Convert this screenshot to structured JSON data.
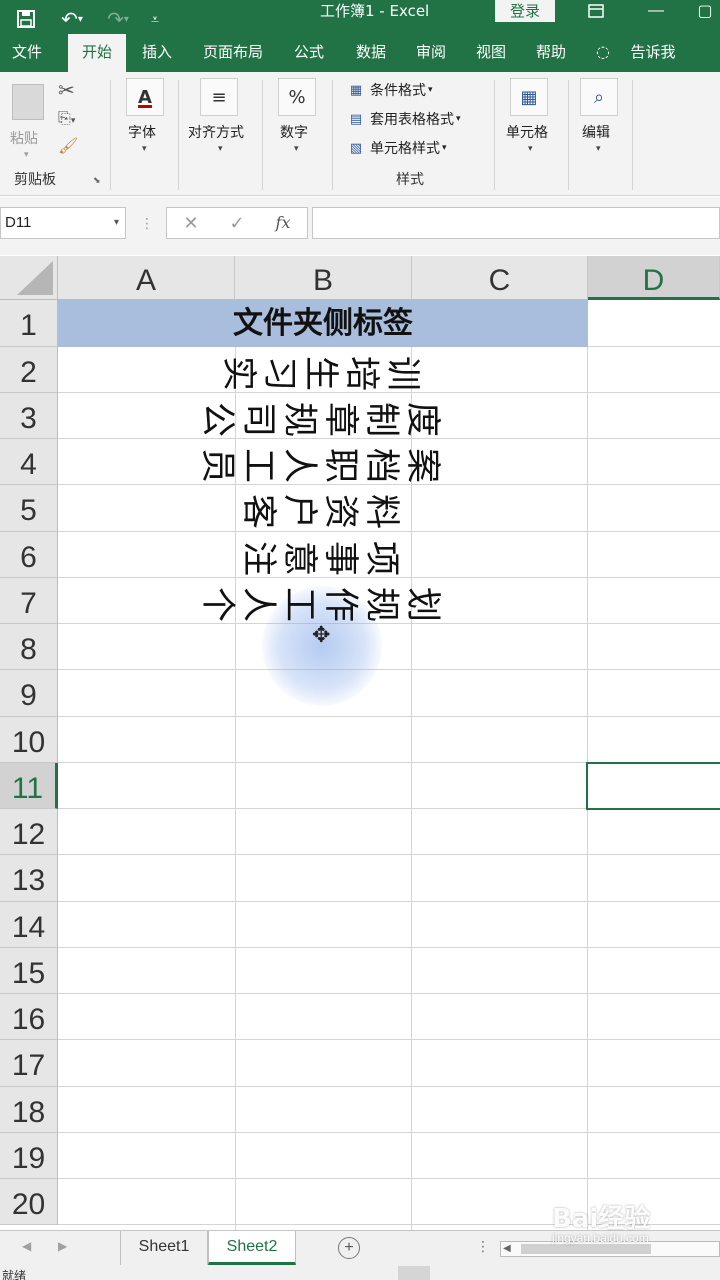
{
  "app": {
    "title": "工作簿1 - Excel",
    "login_label": "登录",
    "accent_color": "#217346"
  },
  "ribbon_tabs": [
    {
      "label": "文件"
    },
    {
      "label": "开始"
    },
    {
      "label": "插入"
    },
    {
      "label": "页面布局"
    },
    {
      "label": "公式"
    },
    {
      "label": "数据"
    },
    {
      "label": "审阅"
    },
    {
      "label": "视图"
    },
    {
      "label": "帮助"
    },
    {
      "label": "告诉我"
    }
  ],
  "ribbon": {
    "paste_label": "粘贴",
    "clipboard_group": "剪贴板",
    "font_label": "字体",
    "alignment_label": "对齐方式",
    "number_label": "数字",
    "conditional_format": "条件格式",
    "format_as_table": "套用表格格式",
    "cell_styles": "单元格样式",
    "styles_group": "样式",
    "cells_label": "单元格",
    "editing_label": "编辑"
  },
  "formula_bar": {
    "name_box": "D11",
    "fx_label": "fx",
    "content": ""
  },
  "grid": {
    "columns": [
      "A",
      "B",
      "C",
      "D"
    ],
    "rows": [
      "1",
      "2",
      "3",
      "4",
      "5",
      "6",
      "7",
      "8",
      "9",
      "10",
      "11",
      "12",
      "13",
      "14",
      "15",
      "16",
      "17",
      "18",
      "19",
      "20"
    ],
    "selected_cell": "D11",
    "title_cell": "文件夹侧标签",
    "vertical_entries": [
      "实习生培训",
      "公司规章制度",
      "员工人职档案",
      "客户资料",
      "注意事项",
      "个人工作规划"
    ]
  },
  "sheets": [
    {
      "name": "Sheet1",
      "active": false
    },
    {
      "name": "Sheet2",
      "active": true
    }
  ],
  "status": {
    "ready": "就绪"
  },
  "watermark": {
    "main": "Bai经验",
    "sub": "jingyan.baidu.com"
  }
}
